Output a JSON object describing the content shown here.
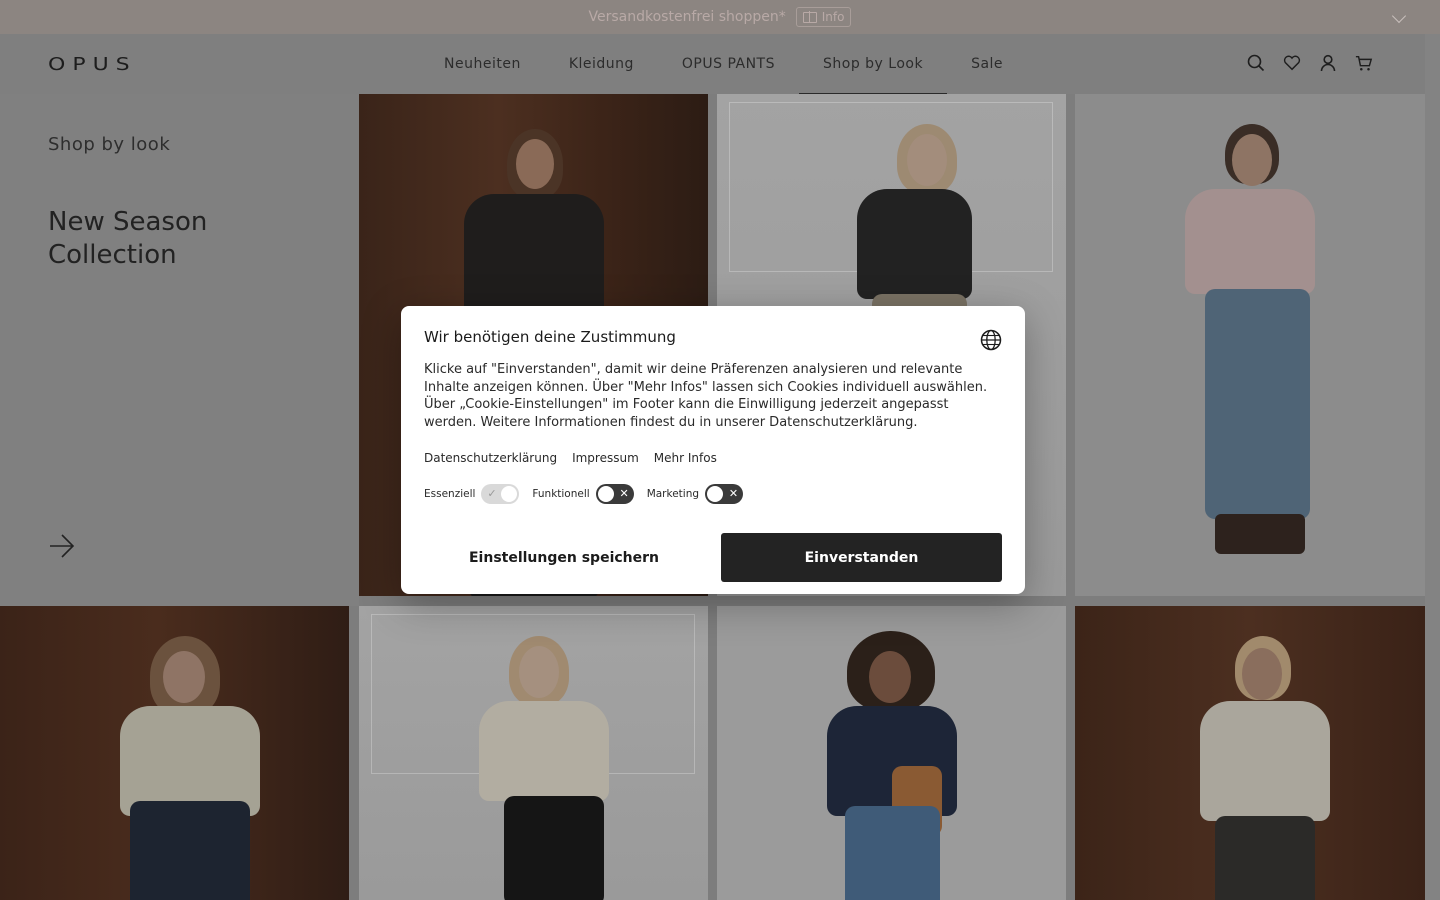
{
  "promo": {
    "text": "Versandkostenfrei shoppen*",
    "badge": "Info"
  },
  "header": {
    "logo": "OPUS",
    "nav": [
      {
        "label": "Neuheiten"
      },
      {
        "label": "Kleidung"
      },
      {
        "label": "OPUS PANTS"
      },
      {
        "label": "Shop by Look"
      },
      {
        "label": "Sale"
      }
    ],
    "active_nav": "Shop by Look",
    "actions": [
      "search-icon",
      "heart-icon",
      "user-icon",
      "cart-icon"
    ]
  },
  "left_panel": {
    "subtitle": "Shop by look",
    "title": "New Season Collection"
  },
  "consent": {
    "title": "Wir benötigen deine Zustimmung",
    "text": "Klicke auf \"Einverstanden\", damit wir deine Präferenzen analysieren und relevante Inhalte anzeigen können. Über \"Mehr Infos\" lassen sich Cookies individuell auswählen. Über „Cookie-Einstellungen\" im Footer kann die Einwilligung jederzeit angepasst werden. Weitere Informationen findest du in unserer Datenschutzerklärung.",
    "links": [
      "Datenschutzerklärung",
      "Impressum",
      "Mehr Infos"
    ],
    "toggles": [
      {
        "label": "Essenziell",
        "state": "on"
      },
      {
        "label": "Funktionell",
        "state": "off"
      },
      {
        "label": "Marketing",
        "state": "off"
      }
    ],
    "save_label": "Einstellungen speichern",
    "accept_label": "Einverstanden"
  },
  "colors": {
    "overlay": "#7f7f7f",
    "button_dark": "#232323",
    "wood": "#3c2418"
  }
}
